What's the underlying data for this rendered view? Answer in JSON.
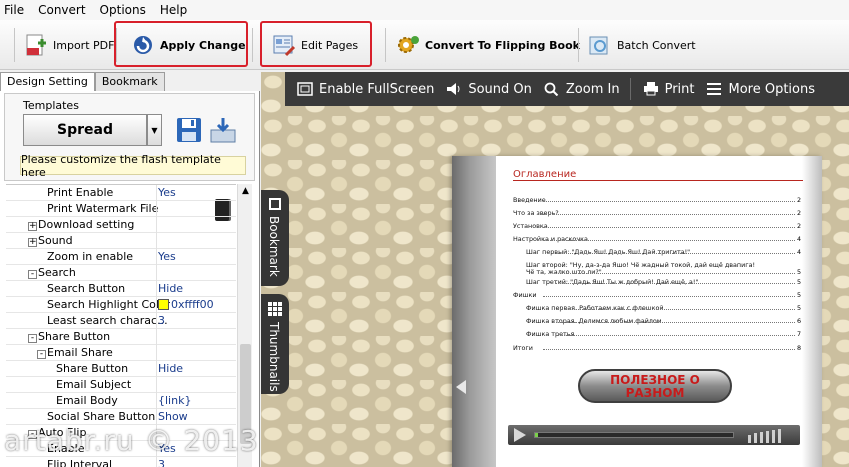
{
  "menu": [
    "File",
    "Convert",
    "Options",
    "Help"
  ],
  "toolbar": {
    "import_pdf": "Import PDF",
    "apply_change": "Apply Change",
    "edit_pages": "Edit Pages",
    "convert": "Convert To Flipping Book",
    "batch_convert": "Batch Convert"
  },
  "tabs": [
    "Design Setting",
    "Bookmark"
  ],
  "templates": {
    "label": "Templates",
    "selected": "Spread",
    "hint": "Please customize the flash template here"
  },
  "properties": [
    {
      "name": "Print Enable",
      "value": "Yes",
      "indent": 2,
      "toggle": ""
    },
    {
      "name": "Print Watermark File",
      "value": "",
      "indent": 2,
      "toggle": ""
    },
    {
      "name": "Download setting",
      "value": "",
      "indent": 1,
      "toggle": "+"
    },
    {
      "name": "Sound",
      "value": "",
      "indent": 1,
      "toggle": "+"
    },
    {
      "name": "Zoom in enable",
      "value": "Yes",
      "indent": 2,
      "toggle": ""
    },
    {
      "name": "Search",
      "value": "",
      "indent": 1,
      "toggle": "-"
    },
    {
      "name": "Search Button",
      "value": "Hide",
      "indent": 2,
      "toggle": ""
    },
    {
      "name": "Search Highlight Color",
      "value": "0xffff00",
      "indent": 2,
      "toggle": "",
      "color": "#ffff00"
    },
    {
      "name": "Least search charac...",
      "value": "3",
      "indent": 2,
      "toggle": ""
    },
    {
      "name": "Share Button",
      "value": "",
      "indent": 1,
      "toggle": "-"
    },
    {
      "name": "Email Share",
      "value": "",
      "indent": 2,
      "toggle": "-"
    },
    {
      "name": "Share Button",
      "value": "Hide",
      "indent": 3,
      "toggle": ""
    },
    {
      "name": "Email Subject",
      "value": "",
      "indent": 3,
      "toggle": ""
    },
    {
      "name": "Email Body",
      "value": "{link}",
      "indent": 3,
      "toggle": ""
    },
    {
      "name": "Social Share Button",
      "value": "Show",
      "indent": 2,
      "toggle": ""
    },
    {
      "name": "Auto Flip",
      "value": "",
      "indent": 1,
      "toggle": "-"
    },
    {
      "name": "Enable",
      "value": "Yes",
      "indent": 2,
      "toggle": ""
    },
    {
      "name": "Flip Interval",
      "value": "3",
      "indent": 2,
      "toggle": ""
    }
  ],
  "preview_toolbar": {
    "fullscreen": "Enable FullScreen",
    "sound": "Sound On",
    "zoom": "Zoom In",
    "print": "Print",
    "more": "More Options"
  },
  "side_tabs": [
    "Bookmark",
    "Thumbnails"
  ],
  "book": {
    "toc_title": "Оглавление",
    "entries": [
      {
        "text": "Введение",
        "page": "2",
        "indent": 0
      },
      {
        "text": "Что за зверь?",
        "page": "2",
        "indent": 0
      },
      {
        "text": "Установка",
        "page": "2",
        "indent": 0
      },
      {
        "text": "Настройка и раскочка",
        "page": "4",
        "indent": 0
      },
      {
        "text": "Шаг первый: \"Дадь Яш! Дадь Яш! Дай тригита!\"",
        "page": "4",
        "indent": 1
      },
      {
        "text": "Шаг второй: \"Ну, да-з-да Яшо! Чё жадный токой, дай ещё двапига!",
        "page": "",
        "indent": 1
      },
      {
        "text": "Чё та, жалко што ли?\"",
        "page": "5",
        "indent": 1
      },
      {
        "text": "Шаг третий: \"Дадь Яш! Ты ж добрый! Дай ещё, а!\"",
        "page": "5",
        "indent": 1
      },
      {
        "text": "Фишки",
        "page": "5",
        "indent": 0
      },
      {
        "text": "Фишка первая. Работаем как с флешкой.",
        "page": "5",
        "indent": 1
      },
      {
        "text": "Фишка вторая. Делимся любым файлом.",
        "page": "6",
        "indent": 1
      },
      {
        "text": "Фишка третья",
        "page": "7",
        "indent": 1
      },
      {
        "text": "Итоги",
        "page": "8",
        "indent": 0
      }
    ],
    "button_line1": "ПОЛЕЗНОЕ О",
    "button_line2": "РАЗНОМ"
  },
  "watermark": "artabr.ru © 2013",
  "colors": {
    "highlight_box": "#d8202b",
    "preview_bar": "#3a3a3a",
    "toc_title": "#b8261f"
  }
}
